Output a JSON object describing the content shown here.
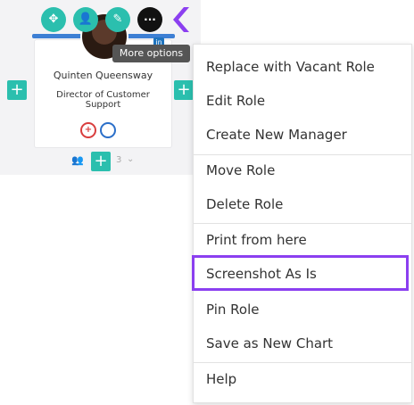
{
  "card": {
    "name": "Quinten Queensway",
    "title": "Director of Customer Support",
    "avatar_badge": "in",
    "direct_reports_count": "3"
  },
  "toolbar": {
    "buttons": [
      "move-icon",
      "person-icon",
      "pencil-icon",
      "ellipsis-icon"
    ],
    "more_label": "···"
  },
  "tooltip": {
    "text": "More options"
  },
  "context_menu": {
    "items": [
      "Replace with Vacant Role",
      "Edit Role",
      "Create New Manager",
      "Move Role",
      "Delete Role",
      "Print from here",
      "Screenshot As Is",
      "Pin Role",
      "Save as New Chart",
      "Help"
    ],
    "highlighted_item": "Screenshot As Is"
  },
  "colors": {
    "accent_teal": "#2bbfae",
    "highlight_purple": "#8b3ff0",
    "role_red": "#d93e3e",
    "role_blue": "#2b6fc9"
  }
}
